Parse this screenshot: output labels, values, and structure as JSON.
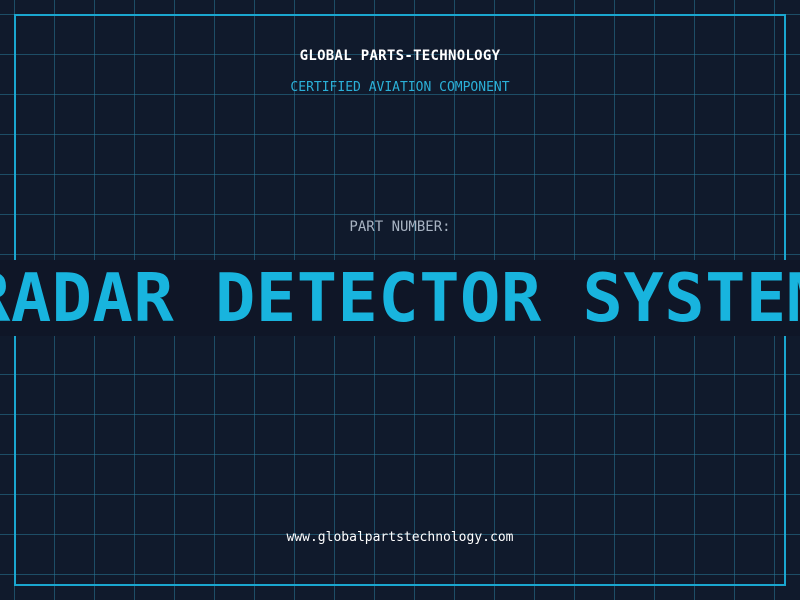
{
  "header": {
    "company": "GLOBAL PARTS-TECHNOLOGY",
    "tagline": "CERTIFIED AVIATION COMPONENT"
  },
  "part": {
    "label": "PART NUMBER:",
    "name": "RADAR DETECTOR SYSTEM"
  },
  "footer": {
    "website": "www.globalpartstechnology.com"
  },
  "colors": {
    "background": "#101a2c",
    "grid": "#287696",
    "frame": "#1aa6cf",
    "accent": "#18b4de",
    "label": "#a8b3c2",
    "text": "#ffffff"
  }
}
